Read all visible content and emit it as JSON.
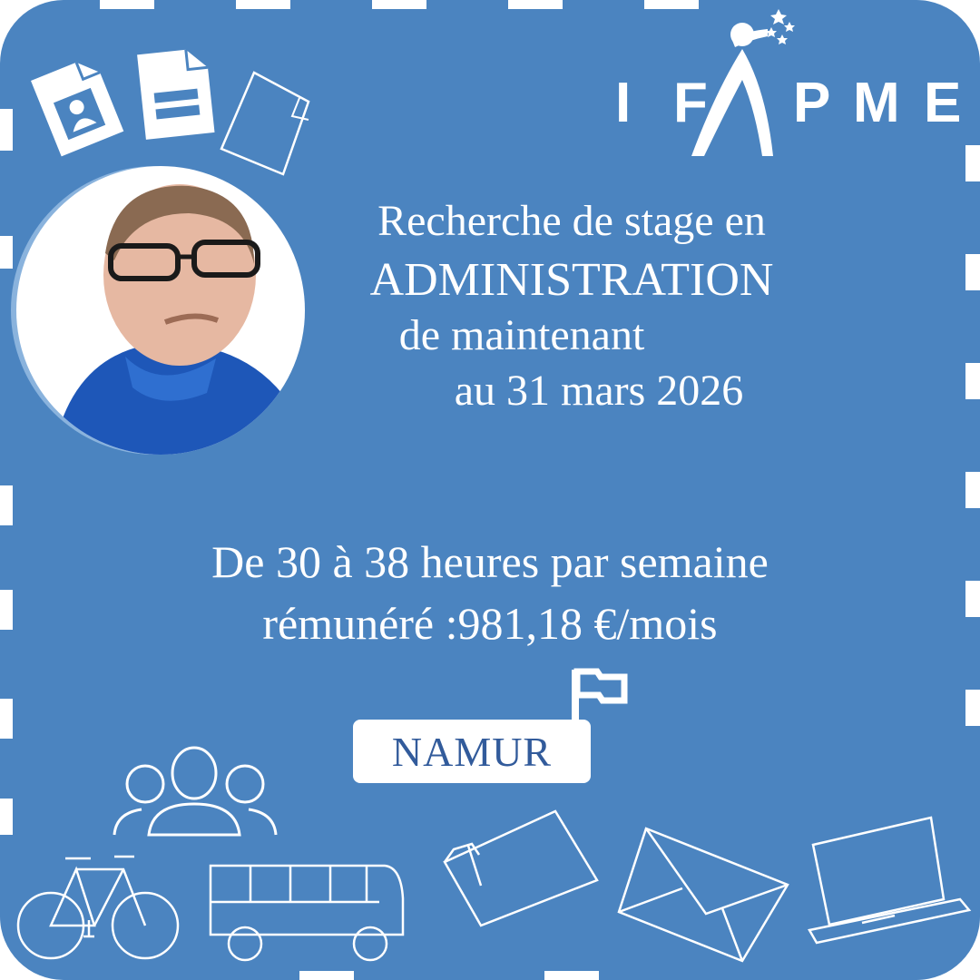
{
  "poster": {
    "background_color": "#4b84c0",
    "logo": {
      "text": "IFAPME",
      "letters": [
        "I",
        "F",
        "P",
        "M",
        "E"
      ]
    },
    "headline": {
      "line1": "Recherche de stage en",
      "line2": "ADMINISTRATION",
      "line3": "de maintenant",
      "line4": "au 31 mars 2026"
    },
    "details": {
      "hours": "De 30 à 38 heures par semaine",
      "salary": "rémunéré :981,18 €/mois"
    },
    "location": "NAMUR",
    "icons": [
      "id-card-document-icon",
      "form-document-icon",
      "blank-document-icon",
      "flag-icon",
      "people-group-icon",
      "bicycle-icon",
      "bus-icon",
      "folder-icon",
      "envelope-icon",
      "laptop-icon"
    ]
  }
}
